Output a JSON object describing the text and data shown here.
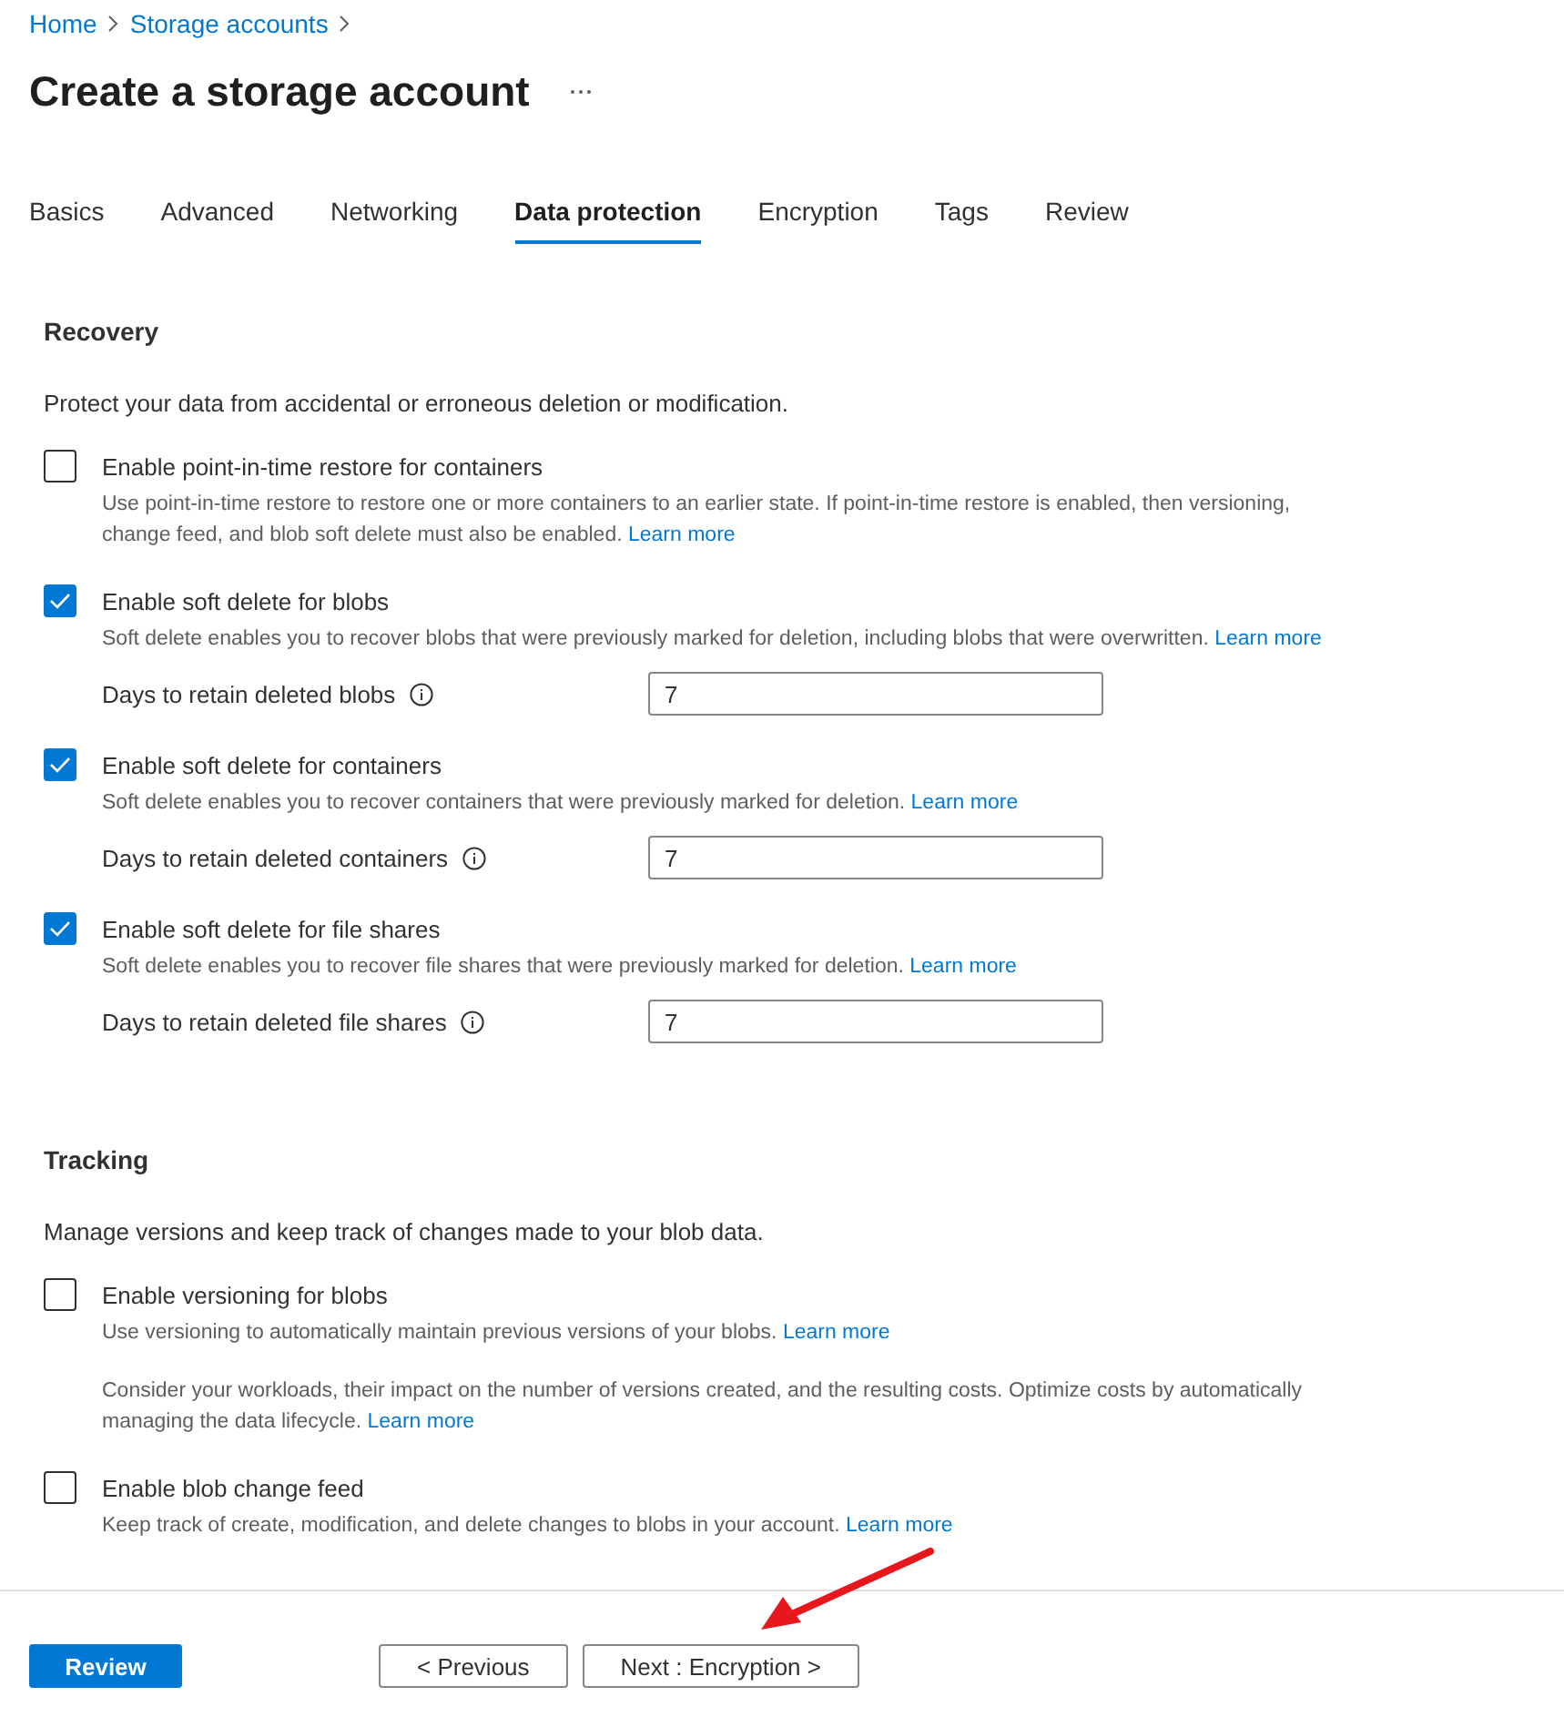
{
  "breadcrumb": [
    "Home",
    "Storage accounts"
  ],
  "title": "Create a storage account",
  "tabs": [
    {
      "label": "Basics",
      "selected": false
    },
    {
      "label": "Advanced",
      "selected": false
    },
    {
      "label": "Networking",
      "selected": false
    },
    {
      "label": "Data protection",
      "selected": true
    },
    {
      "label": "Encryption",
      "selected": false
    },
    {
      "label": "Tags",
      "selected": false
    },
    {
      "label": "Review",
      "selected": false
    }
  ],
  "sections": [
    {
      "heading": "Recovery",
      "description": "Protect your data from accidental or erroneous deletion or modification.",
      "options": [
        {
          "label": "Enable point-in-time restore for containers",
          "checked": false,
          "help": [
            {
              "text": "Use point-in-time restore to restore one or more containers to an earlier state. If point-in-time restore is enabled, then versioning, change feed, and blob soft delete must also be enabled.",
              "link": "Learn more"
            }
          ]
        },
        {
          "label": "Enable soft delete for blobs",
          "checked": true,
          "help": [
            {
              "text": "Soft delete enables you to recover blobs that were previously marked for deletion, including blobs that were overwritten.",
              "link": "Learn more"
            }
          ],
          "field": {
            "label": "Days to retain deleted blobs",
            "value": "7"
          }
        },
        {
          "label": "Enable soft delete for containers",
          "checked": true,
          "help": [
            {
              "text": "Soft delete enables you to recover containers that were previously marked for deletion.",
              "link": "Learn more"
            }
          ],
          "field": {
            "label": "Days to retain deleted containers",
            "value": "7"
          }
        },
        {
          "label": "Enable soft delete for file shares",
          "checked": true,
          "help": [
            {
              "text": "Soft delete enables you to recover file shares that were previously marked for deletion.",
              "link": "Learn more"
            }
          ],
          "field": {
            "label": "Days to retain deleted file shares",
            "value": "7"
          }
        }
      ]
    },
    {
      "heading": "Tracking",
      "description": "Manage versions and keep track of changes made to your blob data.",
      "options": [
        {
          "label": "Enable versioning for blobs",
          "checked": false,
          "help": [
            {
              "text": "Use versioning to automatically maintain previous versions of your blobs.",
              "link": "Learn more"
            },
            {
              "text": "Consider your workloads, their impact on the number of versions created, and the resulting costs. Optimize costs by automatically managing the data lifecycle.",
              "link": "Learn more"
            }
          ]
        },
        {
          "label": "Enable blob change feed",
          "checked": false,
          "help": [
            {
              "text": "Keep track of create, modification, and delete changes to blobs in your account.",
              "link": "Learn more"
            }
          ]
        }
      ]
    }
  ],
  "footer": {
    "review": "Review",
    "previous": "< Previous",
    "next": "Next : Encryption >"
  }
}
